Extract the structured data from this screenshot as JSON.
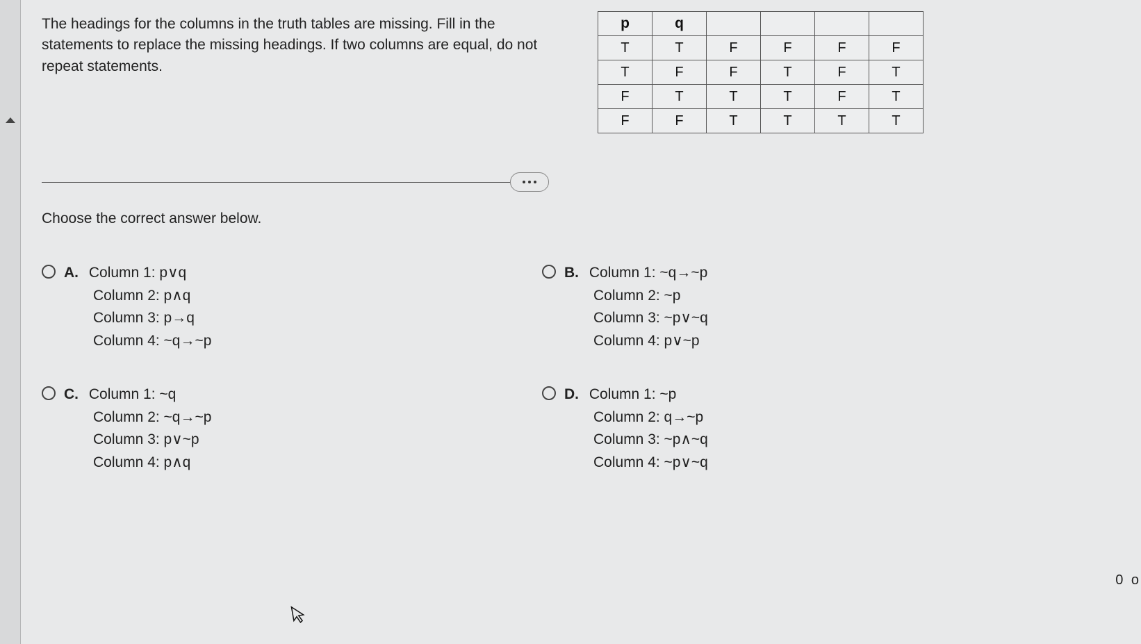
{
  "question": "The headings for the columns in the truth tables are missing. Fill in the statements to replace the missing headings. If two columns are equal, do not repeat statements.",
  "table": {
    "headers": [
      "p",
      "q",
      "",
      "",
      "",
      ""
    ],
    "rows": [
      [
        "T",
        "T",
        "F",
        "F",
        "F",
        "F"
      ],
      [
        "T",
        "F",
        "F",
        "T",
        "F",
        "T"
      ],
      [
        "F",
        "T",
        "T",
        "T",
        "F",
        "T"
      ],
      [
        "F",
        "F",
        "T",
        "T",
        "T",
        "T"
      ]
    ]
  },
  "instruction": "Choose the correct answer below.",
  "options": {
    "A": {
      "label": "A.",
      "lines": [
        "Column 1: p∨q",
        "Column 2: p∧q",
        "Column 3: p→q",
        "Column 4: ~q→~p"
      ]
    },
    "B": {
      "label": "B.",
      "lines": [
        "Column 1: ~q→~p",
        "Column 2: ~p",
        "Column 3: ~p∨~q",
        "Column 4: p∨~p"
      ]
    },
    "C": {
      "label": "C.",
      "lines": [
        "Column 1: ~q",
        "Column 2: ~q→~p",
        "Column 3: p∨~p",
        "Column 4: p∧q"
      ]
    },
    "D": {
      "label": "D.",
      "lines": [
        "Column 1: ~p",
        "Column 2: q→~p",
        "Column 3: ~p∧~q",
        "Column 4: ~p∨~q"
      ]
    }
  },
  "footer": "0 o"
}
